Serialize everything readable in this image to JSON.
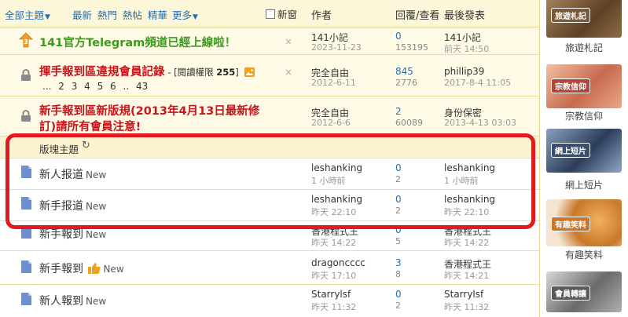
{
  "header": {
    "filters": [
      {
        "label": "全部主題",
        "caret": true
      },
      {
        "label": "最新",
        "caret": false
      },
      {
        "label": "熱門",
        "caret": false
      },
      {
        "label": "熱帖",
        "caret": false
      },
      {
        "label": "精華",
        "caret": false
      },
      {
        "label": "更多",
        "caret": true
      }
    ],
    "new_window": "新窗",
    "col_author": "作者",
    "col_reply_view": "回覆/查看",
    "col_last_post": "最後發表"
  },
  "sticky": [
    {
      "title": "141官方Telegram頻道已經上線啦！",
      "author": "141小記",
      "date": "2023-11-23",
      "replies": "0",
      "views": "153195",
      "last_user": "141小記",
      "last_time": "前天 14:50",
      "close": "×"
    },
    {
      "title": "揮手報到區違規會員記錄",
      "perm_prefix": "- [閱讀權限",
      "perm_value": "255",
      "perm_suffix": "]",
      "pages": "... 2 3 4 5 6 .. 43",
      "author": "完全自由",
      "date": "2012-6-11",
      "replies": "845",
      "views": "2776",
      "last_user": "phillip39",
      "last_time": "2017-8-4 11:05",
      "close": "×"
    },
    {
      "title_line1": "新手報到區新版規(2013年4月13日最新修",
      "title_line2": "訂)請所有會員注意!",
      "author": "完全自由",
      "date": "2012-6-6",
      "replies": "2",
      "views": "60089",
      "last_user": "身份保密",
      "last_time": "2013-4-13 03:03"
    }
  ],
  "section": {
    "label": "版塊主題"
  },
  "threads": [
    {
      "title": "新人报道",
      "tag": "New",
      "author": "leshanking",
      "date": "1 小時前",
      "replies": "0",
      "views": "2",
      "last_user": "leshanking",
      "last_time": "1 小時前"
    },
    {
      "title": "新手报道",
      "tag": "New",
      "author": "leshanking",
      "date": "昨天 22:10",
      "replies": "0",
      "views": "2",
      "last_user": "leshanking",
      "last_time": "昨天 22:10"
    },
    {
      "title": "新手報到",
      "tag": "New",
      "author": "香港程式王",
      "date": "昨天 14:22",
      "replies": "0",
      "views": "5",
      "last_user": "香港程式王",
      "last_time": "昨天 14:22"
    },
    {
      "title": "新手報到",
      "tag": "New",
      "author": "dragoncccc",
      "date": "昨天 17:10",
      "replies": "3",
      "views": "8",
      "last_user": "香港程式王",
      "last_time": "昨天 14:21"
    },
    {
      "title": "新人報到",
      "tag": "New",
      "author": "Starrylsf",
      "date": "昨天 11:32",
      "replies": "0",
      "views": "2",
      "last_user": "Starrylsf",
      "last_time": "昨天 11:32"
    }
  ],
  "sidebar": [
    {
      "thumb_label": "旅遊札記",
      "label": "旅遊札記",
      "color": "#7a5a3a"
    },
    {
      "thumb_label": "宗教信仰",
      "label": "宗教信仰",
      "color": "#b2473a"
    },
    {
      "thumb_label": "網上短片",
      "label": "網上短片",
      "color": "#3a5070"
    },
    {
      "thumb_label": "有趣笑料",
      "label": "有趣笑料",
      "color": "#c8782a"
    },
    {
      "thumb_label": "會員轉讓",
      "label": "",
      "color": "#5a5a5a"
    }
  ],
  "colors": {
    "header_bg": "#fdf7d9",
    "sticky_bg": "#fffae6",
    "link_blue": "#2a6fb0",
    "title_green": "#3c9a1e",
    "title_red": "#c4161c",
    "highlight_red": "#e11a1f"
  }
}
